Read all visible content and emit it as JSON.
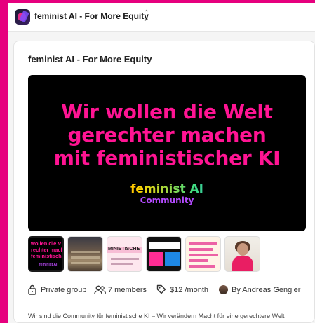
{
  "header": {
    "app_title": "feminist AI - For More Equity",
    "switcher_icon": "chevron-up-down-icon"
  },
  "group": {
    "title": "feminist AI - For More Equity",
    "banner": {
      "line1": "Wir wollen die Welt",
      "line2": "gerechter machen",
      "line3": "mit feministischer KI",
      "logo_main": "feminist AI",
      "logo_sub": "Community",
      "text_color": "#ff1493"
    },
    "thumbnails": [
      {
        "text": [
          "wollen die V",
          "rechter mach",
          "feministisch"
        ],
        "logo": "feminist AI"
      },
      {
        "text": []
      },
      {
        "text": [
          "MINISTISCHE"
        ]
      },
      {
        "text": []
      },
      {
        "text": []
      },
      {
        "text": []
      }
    ],
    "meta": {
      "privacy": "Private group",
      "members": "7 members",
      "price": "$12 /month",
      "author": "By Andreas Gengler"
    },
    "description": "Wir sind die Community für feministische KI – Wir verändern Macht für eine gerechtere Welt"
  },
  "colors": {
    "frame": "#e6007e",
    "banner_text": "#ff1493",
    "accent_purple": "#b44bff"
  }
}
